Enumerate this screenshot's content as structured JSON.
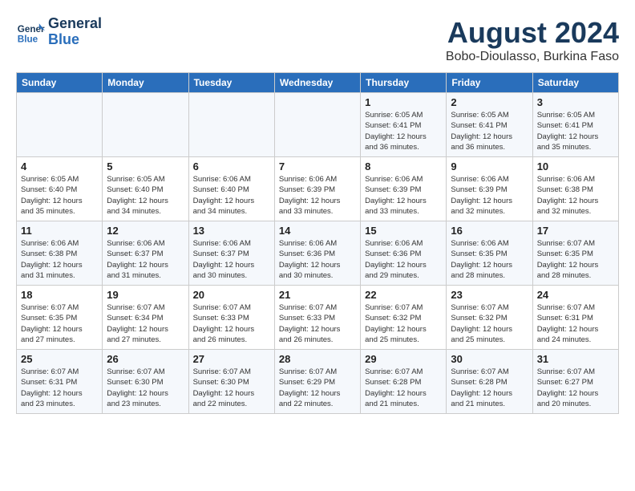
{
  "header": {
    "logo_line1": "General",
    "logo_line2": "Blue",
    "month_year": "August 2024",
    "location": "Bobo-Dioulasso, Burkina Faso"
  },
  "weekdays": [
    "Sunday",
    "Monday",
    "Tuesday",
    "Wednesday",
    "Thursday",
    "Friday",
    "Saturday"
  ],
  "weeks": [
    [
      {
        "day": "",
        "info": ""
      },
      {
        "day": "",
        "info": ""
      },
      {
        "day": "",
        "info": ""
      },
      {
        "day": "",
        "info": ""
      },
      {
        "day": "1",
        "info": "Sunrise: 6:05 AM\nSunset: 6:41 PM\nDaylight: 12 hours\nand 36 minutes."
      },
      {
        "day": "2",
        "info": "Sunrise: 6:05 AM\nSunset: 6:41 PM\nDaylight: 12 hours\nand 36 minutes."
      },
      {
        "day": "3",
        "info": "Sunrise: 6:05 AM\nSunset: 6:41 PM\nDaylight: 12 hours\nand 35 minutes."
      }
    ],
    [
      {
        "day": "4",
        "info": "Sunrise: 6:05 AM\nSunset: 6:40 PM\nDaylight: 12 hours\nand 35 minutes."
      },
      {
        "day": "5",
        "info": "Sunrise: 6:05 AM\nSunset: 6:40 PM\nDaylight: 12 hours\nand 34 minutes."
      },
      {
        "day": "6",
        "info": "Sunrise: 6:06 AM\nSunset: 6:40 PM\nDaylight: 12 hours\nand 34 minutes."
      },
      {
        "day": "7",
        "info": "Sunrise: 6:06 AM\nSunset: 6:39 PM\nDaylight: 12 hours\nand 33 minutes."
      },
      {
        "day": "8",
        "info": "Sunrise: 6:06 AM\nSunset: 6:39 PM\nDaylight: 12 hours\nand 33 minutes."
      },
      {
        "day": "9",
        "info": "Sunrise: 6:06 AM\nSunset: 6:39 PM\nDaylight: 12 hours\nand 32 minutes."
      },
      {
        "day": "10",
        "info": "Sunrise: 6:06 AM\nSunset: 6:38 PM\nDaylight: 12 hours\nand 32 minutes."
      }
    ],
    [
      {
        "day": "11",
        "info": "Sunrise: 6:06 AM\nSunset: 6:38 PM\nDaylight: 12 hours\nand 31 minutes."
      },
      {
        "day": "12",
        "info": "Sunrise: 6:06 AM\nSunset: 6:37 PM\nDaylight: 12 hours\nand 31 minutes."
      },
      {
        "day": "13",
        "info": "Sunrise: 6:06 AM\nSunset: 6:37 PM\nDaylight: 12 hours\nand 30 minutes."
      },
      {
        "day": "14",
        "info": "Sunrise: 6:06 AM\nSunset: 6:36 PM\nDaylight: 12 hours\nand 30 minutes."
      },
      {
        "day": "15",
        "info": "Sunrise: 6:06 AM\nSunset: 6:36 PM\nDaylight: 12 hours\nand 29 minutes."
      },
      {
        "day": "16",
        "info": "Sunrise: 6:06 AM\nSunset: 6:35 PM\nDaylight: 12 hours\nand 28 minutes."
      },
      {
        "day": "17",
        "info": "Sunrise: 6:07 AM\nSunset: 6:35 PM\nDaylight: 12 hours\nand 28 minutes."
      }
    ],
    [
      {
        "day": "18",
        "info": "Sunrise: 6:07 AM\nSunset: 6:35 PM\nDaylight: 12 hours\nand 27 minutes."
      },
      {
        "day": "19",
        "info": "Sunrise: 6:07 AM\nSunset: 6:34 PM\nDaylight: 12 hours\nand 27 minutes."
      },
      {
        "day": "20",
        "info": "Sunrise: 6:07 AM\nSunset: 6:33 PM\nDaylight: 12 hours\nand 26 minutes."
      },
      {
        "day": "21",
        "info": "Sunrise: 6:07 AM\nSunset: 6:33 PM\nDaylight: 12 hours\nand 26 minutes."
      },
      {
        "day": "22",
        "info": "Sunrise: 6:07 AM\nSunset: 6:32 PM\nDaylight: 12 hours\nand 25 minutes."
      },
      {
        "day": "23",
        "info": "Sunrise: 6:07 AM\nSunset: 6:32 PM\nDaylight: 12 hours\nand 25 minutes."
      },
      {
        "day": "24",
        "info": "Sunrise: 6:07 AM\nSunset: 6:31 PM\nDaylight: 12 hours\nand 24 minutes."
      }
    ],
    [
      {
        "day": "25",
        "info": "Sunrise: 6:07 AM\nSunset: 6:31 PM\nDaylight: 12 hours\nand 23 minutes."
      },
      {
        "day": "26",
        "info": "Sunrise: 6:07 AM\nSunset: 6:30 PM\nDaylight: 12 hours\nand 23 minutes."
      },
      {
        "day": "27",
        "info": "Sunrise: 6:07 AM\nSunset: 6:30 PM\nDaylight: 12 hours\nand 22 minutes."
      },
      {
        "day": "28",
        "info": "Sunrise: 6:07 AM\nSunset: 6:29 PM\nDaylight: 12 hours\nand 22 minutes."
      },
      {
        "day": "29",
        "info": "Sunrise: 6:07 AM\nSunset: 6:28 PM\nDaylight: 12 hours\nand 21 minutes."
      },
      {
        "day": "30",
        "info": "Sunrise: 6:07 AM\nSunset: 6:28 PM\nDaylight: 12 hours\nand 21 minutes."
      },
      {
        "day": "31",
        "info": "Sunrise: 6:07 AM\nSunset: 6:27 PM\nDaylight: 12 hours\nand 20 minutes."
      }
    ]
  ]
}
